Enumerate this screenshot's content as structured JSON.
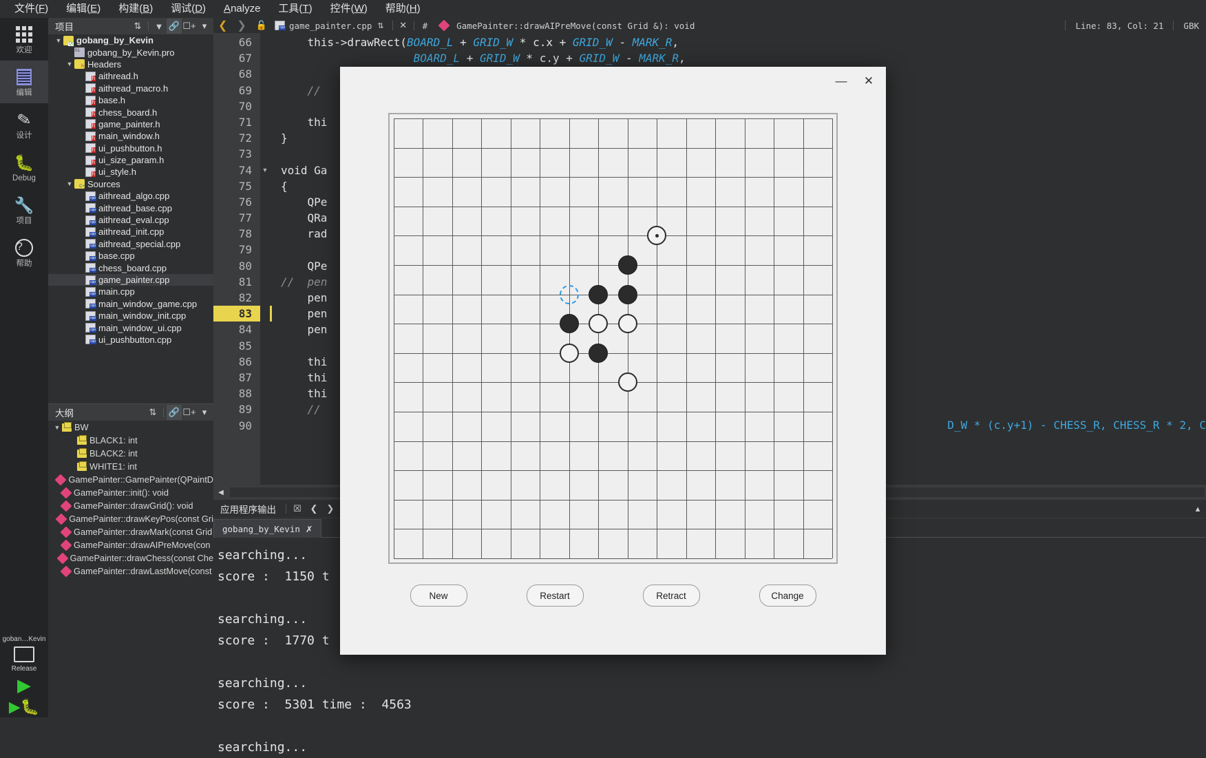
{
  "menubar": {
    "items": [
      {
        "pre": "文件(",
        "key": "F",
        "post": ")"
      },
      {
        "pre": "编辑(",
        "key": "E",
        "post": ")"
      },
      {
        "pre": "构建(",
        "key": "B",
        "post": ")"
      },
      {
        "pre": "调试(",
        "key": "D",
        "post": ")"
      },
      {
        "pre": "",
        "key": "A",
        "post": "nalyze"
      },
      {
        "pre": "工具(",
        "key": "T",
        "post": ")"
      },
      {
        "pre": "控件(",
        "key": "W",
        "post": ")"
      },
      {
        "pre": "帮助(",
        "key": "H",
        "post": ")"
      }
    ]
  },
  "modebar": {
    "items": [
      {
        "label": "欢迎",
        "icon": "grid-dots-icon",
        "selected": false
      },
      {
        "label": "编辑",
        "icon": "document-lines-icon",
        "selected": true
      },
      {
        "label": "设计",
        "icon": "pencil-icon",
        "selected": false
      },
      {
        "label": "Debug",
        "icon": "bug-icon",
        "selected": false
      },
      {
        "label": "项目",
        "icon": "wrench-icon",
        "selected": false
      },
      {
        "label": "帮助",
        "icon": "question-mark-icon",
        "selected": false
      }
    ],
    "kit_line1": "goban…Kevin",
    "kit_line2": "Release",
    "run_icon": "play-icon",
    "debug_icon": "debug-play-icon"
  },
  "project_panel": {
    "title": "项目",
    "toolbar_icons": [
      "sort-updown-icon",
      "filter-icon",
      "link-icon",
      "split-add-icon",
      "dropdown-icon"
    ],
    "tree": [
      {
        "depth": 0,
        "label": "gobang_by_Kevin",
        "icon": "qt-project-icon",
        "expander": "down",
        "bold": true,
        "selected": false
      },
      {
        "depth": 1,
        "label": "gobang_by_Kevin.pro",
        "icon": "pro-file-icon",
        "expander": "",
        "bold": false,
        "selected": false
      },
      {
        "depth": 1,
        "label": "Headers",
        "icon": "headers-folder-icon",
        "expander": "down",
        "bold": false,
        "selected": false
      },
      {
        "depth": 2,
        "label": "aithread.h",
        "icon": "h-file-icon",
        "expander": "",
        "bold": false,
        "selected": false
      },
      {
        "depth": 2,
        "label": "aithread_macro.h",
        "icon": "h-file-icon",
        "expander": "",
        "bold": false,
        "selected": false
      },
      {
        "depth": 2,
        "label": "base.h",
        "icon": "h-file-icon",
        "expander": "",
        "bold": false,
        "selected": false
      },
      {
        "depth": 2,
        "label": "chess_board.h",
        "icon": "h-file-icon",
        "expander": "",
        "bold": false,
        "selected": false
      },
      {
        "depth": 2,
        "label": "game_painter.h",
        "icon": "h-file-icon",
        "expander": "",
        "bold": false,
        "selected": false
      },
      {
        "depth": 2,
        "label": "main_window.h",
        "icon": "h-file-icon",
        "expander": "",
        "bold": false,
        "selected": false
      },
      {
        "depth": 2,
        "label": "ui_pushbutton.h",
        "icon": "h-file-icon",
        "expander": "",
        "bold": false,
        "selected": false
      },
      {
        "depth": 2,
        "label": "ui_size_param.h",
        "icon": "h-file-icon",
        "expander": "",
        "bold": false,
        "selected": false
      },
      {
        "depth": 2,
        "label": "ui_style.h",
        "icon": "h-file-icon",
        "expander": "",
        "bold": false,
        "selected": false
      },
      {
        "depth": 1,
        "label": "Sources",
        "icon": "sources-folder-icon",
        "expander": "down",
        "bold": false,
        "selected": false
      },
      {
        "depth": 2,
        "label": "aithread_algo.cpp",
        "icon": "cpp-file-icon",
        "expander": "",
        "bold": false,
        "selected": false
      },
      {
        "depth": 2,
        "label": "aithread_base.cpp",
        "icon": "cpp-file-icon",
        "expander": "",
        "bold": false,
        "selected": false
      },
      {
        "depth": 2,
        "label": "aithread_eval.cpp",
        "icon": "cpp-file-icon",
        "expander": "",
        "bold": false,
        "selected": false
      },
      {
        "depth": 2,
        "label": "aithread_init.cpp",
        "icon": "cpp-file-icon",
        "expander": "",
        "bold": false,
        "selected": false
      },
      {
        "depth": 2,
        "label": "aithread_special.cpp",
        "icon": "cpp-file-icon",
        "expander": "",
        "bold": false,
        "selected": false
      },
      {
        "depth": 2,
        "label": "base.cpp",
        "icon": "cpp-file-icon",
        "expander": "",
        "bold": false,
        "selected": false
      },
      {
        "depth": 2,
        "label": "chess_board.cpp",
        "icon": "cpp-file-icon",
        "expander": "",
        "bold": false,
        "selected": false
      },
      {
        "depth": 2,
        "label": "game_painter.cpp",
        "icon": "cpp-file-icon",
        "expander": "",
        "bold": false,
        "selected": true
      },
      {
        "depth": 2,
        "label": "main.cpp",
        "icon": "cpp-file-icon",
        "expander": "",
        "bold": false,
        "selected": false
      },
      {
        "depth": 2,
        "label": "main_window_game.cpp",
        "icon": "cpp-file-icon",
        "expander": "",
        "bold": false,
        "selected": false
      },
      {
        "depth": 2,
        "label": "main_window_init.cpp",
        "icon": "cpp-file-icon",
        "expander": "",
        "bold": false,
        "selected": false
      },
      {
        "depth": 2,
        "label": "main_window_ui.cpp",
        "icon": "cpp-file-icon",
        "expander": "",
        "bold": false,
        "selected": false
      },
      {
        "depth": 2,
        "label": "ui_pushbutton.cpp",
        "icon": "cpp-file-icon",
        "expander": "",
        "bold": false,
        "selected": false
      }
    ]
  },
  "outline_panel": {
    "title": "大纲",
    "toolbar_icons": [
      "sort-updown-icon",
      "link-icon",
      "split-add-icon",
      "dropdown-icon"
    ],
    "items": [
      {
        "depth": 0,
        "label": "BW",
        "kind": "enum",
        "expander": "down"
      },
      {
        "depth": 1,
        "label": "BLACK1: int",
        "kind": "enum",
        "expander": ""
      },
      {
        "depth": 1,
        "label": "BLACK2: int",
        "kind": "enum",
        "expander": ""
      },
      {
        "depth": 1,
        "label": "WHITE1: int",
        "kind": "enum",
        "expander": ""
      },
      {
        "depth": 0,
        "label": "GamePainter::GamePainter(QPaintD",
        "kind": "func",
        "expander": ""
      },
      {
        "depth": 0,
        "label": "GamePainter::init(): void",
        "kind": "func",
        "expander": ""
      },
      {
        "depth": 0,
        "label": "GamePainter::drawGrid(): void",
        "kind": "func",
        "expander": ""
      },
      {
        "depth": 0,
        "label": "GamePainter::drawKeyPos(const Gri",
        "kind": "func",
        "expander": ""
      },
      {
        "depth": 0,
        "label": "GamePainter::drawMark(const Grid",
        "kind": "func",
        "expander": ""
      },
      {
        "depth": 0,
        "label": "GamePainter::drawAIPreMove(con",
        "kind": "func",
        "expander": ""
      },
      {
        "depth": 0,
        "label": "GamePainter::drawChess(const Che",
        "kind": "func",
        "expander": ""
      },
      {
        "depth": 0,
        "label": "GamePainter::drawLastMove(const",
        "kind": "func",
        "expander": ""
      }
    ]
  },
  "editor": {
    "filename": "game_painter.cpp",
    "symbol": "GamePainter::drawAIPreMove(const Grid &): void",
    "hash_label": "#",
    "nav_back_icon": "chevron-left-icon",
    "nav_forward_icon": "chevron-right-icon",
    "lock_icon": "unlock-icon",
    "close_icon": "close-icon",
    "status_line": "Line: 83, Col: 21",
    "status_encoding": "GBK",
    "current_line": 83,
    "lines": [
      {
        "n": 66,
        "fold": "",
        "html": "    <span class='kw'>this</span>-&gt;<span class='fn'>drawRect</span>(<span class='id-blue-i'>BOARD_L</span> + <span class='id-blue-i'>GRID_W</span> * <span class='kw'>c</span>.<span class='kw'>x</span> + <span class='id-blue-i'>GRID_W</span> - <span class='id-blue-i'>MARK_R</span>,"
      },
      {
        "n": 67,
        "fold": "",
        "html": "                    <span class='id-blue-i'>BOARD_L</span> + <span class='id-blue-i'>GRID_W</span> * <span class='kw'>c</span>.<span class='kw'>y</span> + <span class='id-blue-i'>GRID_W</span> - <span class='id-blue-i'>MARK_R</span>,"
      },
      {
        "n": 68,
        "fold": "",
        "html": ""
      },
      {
        "n": 69,
        "fold": "",
        "html": "    <span class='cm'>//</span>"
      },
      {
        "n": 70,
        "fold": "",
        "html": ""
      },
      {
        "n": 71,
        "fold": "",
        "html": "    <span class='kw'>thi</span>"
      },
      {
        "n": 72,
        "fold": "",
        "html": "}"
      },
      {
        "n": 73,
        "fold": "",
        "html": ""
      },
      {
        "n": 74,
        "fold": "down",
        "html": "<span class='kw'>void</span> Ga"
      },
      {
        "n": 75,
        "fold": "",
        "html": "{"
      },
      {
        "n": 76,
        "fold": "",
        "html": "    QPe"
      },
      {
        "n": 77,
        "fold": "",
        "html": "    QRa"
      },
      {
        "n": 78,
        "fold": "",
        "html": "    rad"
      },
      {
        "n": 79,
        "fold": "",
        "html": ""
      },
      {
        "n": 80,
        "fold": "",
        "html": "    QPe"
      },
      {
        "n": 81,
        "fold": "",
        "html": "<span class='cm'>//  pen</span>"
      },
      {
        "n": 82,
        "fold": "",
        "html": "    pen"
      },
      {
        "n": 83,
        "fold": "",
        "html": "    pen"
      },
      {
        "n": 84,
        "fold": "",
        "html": "    pen"
      },
      {
        "n": 85,
        "fold": "",
        "html": ""
      },
      {
        "n": 86,
        "fold": "",
        "html": "    <span class='kw'>thi</span>"
      },
      {
        "n": 87,
        "fold": "",
        "html": "    <span class='kw'>thi</span>"
      },
      {
        "n": 88,
        "fold": "",
        "html": "    <span class='kw'>thi</span>"
      },
      {
        "n": 89,
        "fold": "",
        "html": "    <span class='cm'>//</span>"
      },
      {
        "n": 90,
        "fold": "",
        "html": ""
      }
    ],
    "right_overflow_line": "D_W * (c.y+1) - CHESS_R, CHESS_R * 2, C"
  },
  "output": {
    "title": "应用程序输出",
    "toolbar_icons": [
      "clear-icon",
      "prev-icon",
      "next-icon"
    ],
    "tab_label": "gobang_by_Kevin",
    "tab_close_icon": "cancel-build-icon",
    "expand_icon": "chevron-up-icon",
    "body": "searching...\nscore :  1150 t\n\nsearching...\nscore :  1770 t\n\nsearching...\nscore :  5301 time :  4563\n\nsearching..."
  },
  "dialog": {
    "minimize_icon": "minimize-icon",
    "close_icon": "close-icon",
    "board": {
      "cols": 15,
      "rows": 15,
      "stones": [
        {
          "col": 9,
          "row": 4,
          "color": "white",
          "last": true
        },
        {
          "col": 8,
          "row": 5,
          "color": "black",
          "last": false
        },
        {
          "col": 7,
          "row": 6,
          "color": "black",
          "last": false
        },
        {
          "col": 8,
          "row": 6,
          "color": "black",
          "last": false
        },
        {
          "col": 6,
          "row": 6,
          "color": "ghost",
          "last": false
        },
        {
          "col": 6,
          "row": 7,
          "color": "black",
          "last": false
        },
        {
          "col": 7,
          "row": 7,
          "color": "white",
          "last": false
        },
        {
          "col": 8,
          "row": 7,
          "color": "white",
          "last": false
        },
        {
          "col": 6,
          "row": 8,
          "color": "white",
          "last": false
        },
        {
          "col": 7,
          "row": 8,
          "color": "black",
          "last": false
        },
        {
          "col": 8,
          "row": 9,
          "color": "white",
          "last": false
        }
      ]
    },
    "buttons": [
      {
        "label": "New",
        "name": "new-game-button"
      },
      {
        "label": "Restart",
        "name": "restart-button"
      },
      {
        "label": "Retract",
        "name": "retract-button"
      },
      {
        "label": "Change",
        "name": "change-button"
      }
    ]
  }
}
